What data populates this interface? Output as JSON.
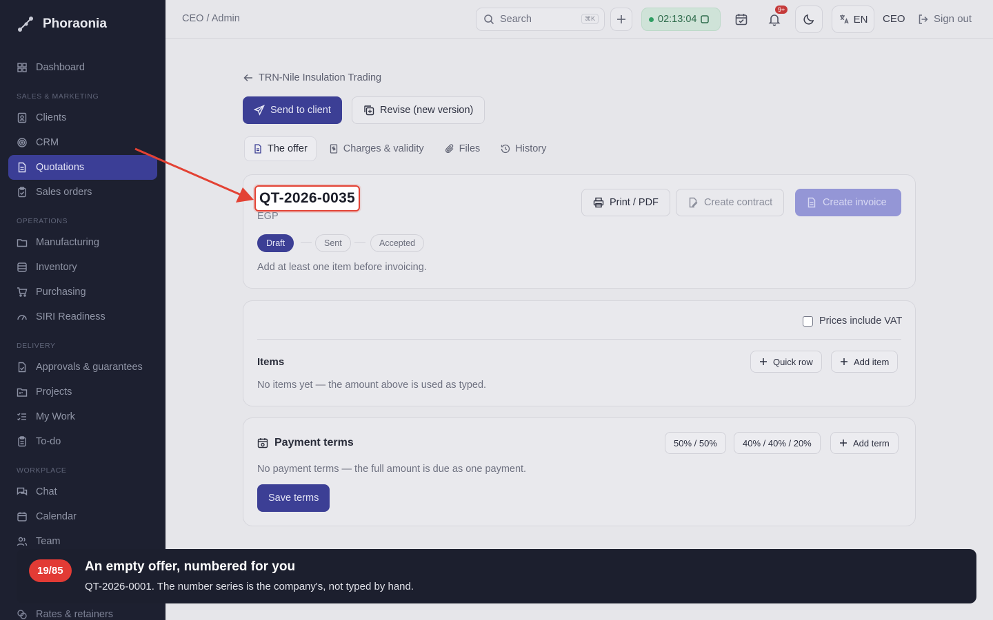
{
  "app": {
    "name": "Phoraonia"
  },
  "sidebar": {
    "dashboard": "Dashboard",
    "sections": {
      "sales": "SALES & MARKETING",
      "operations": "OPERATIONS",
      "delivery": "DELIVERY",
      "workplace": "WORKPLACE"
    },
    "items": {
      "clients": "Clients",
      "crm": "CRM",
      "quotations": "Quotations",
      "sales_orders": "Sales orders",
      "manufacturing": "Manufacturing",
      "inventory": "Inventory",
      "purchasing": "Purchasing",
      "siri": "SIRI Readiness",
      "approvals": "Approvals & guarantees",
      "projects": "Projects",
      "my_work": "My Work",
      "todo": "To-do",
      "chat": "Chat",
      "calendar": "Calendar",
      "team": "Team",
      "rates": "Rates & retainers"
    }
  },
  "header": {
    "breadcrumb": "CEO / Admin",
    "search_placeholder": "Search",
    "search_shortcut": "⌘K",
    "timer": "02:13:04",
    "notif_count": "9+",
    "language": "EN",
    "role": "CEO",
    "sign_out": "Sign out"
  },
  "page": {
    "back_label": "TRN-Nile Insulation Trading",
    "send_label": "Send to client",
    "revise_label": "Revise (new version)",
    "tabs": [
      "The offer",
      "Charges & validity",
      "Files",
      "History"
    ]
  },
  "offer": {
    "number": "QT-2026-0035",
    "currency": "EGP",
    "statuses": [
      "Draft",
      "Sent",
      "Accepted"
    ],
    "hint": "Add at least one item before invoicing.",
    "print_label": "Print / PDF",
    "contract_label": "Create contract",
    "invoice_label": "Create invoice"
  },
  "items_card": {
    "vat_label": "Prices include VAT",
    "title": "Items",
    "quick_row": "Quick row",
    "add_item": "Add item",
    "empty": "No items yet — the amount above is used as typed."
  },
  "payment": {
    "title": "Payment terms",
    "preset1": "50% / 50%",
    "preset2": "40% / 40% / 20%",
    "add_term": "Add term",
    "empty": "No payment terms — the full amount is due as one payment.",
    "save": "Save terms"
  },
  "tour": {
    "step": "19/85",
    "title": "An empty offer, numbered for you",
    "body": "QT-2026-0001. The number series is the company's, not typed by hand."
  },
  "colors": {
    "accent": "#3c3f95",
    "highlight": "#e34234",
    "sidebar": "#1d2030"
  }
}
